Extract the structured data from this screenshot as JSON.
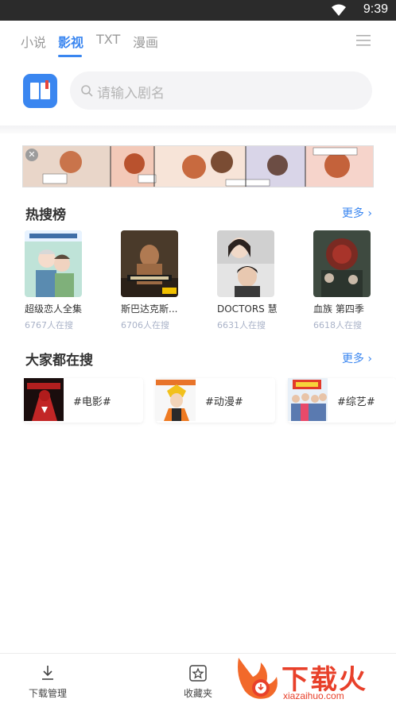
{
  "status_bar": {
    "time": "9:39",
    "wifi_icon": "wifi-icon"
  },
  "tabs": [
    {
      "label": "小说",
      "active": false
    },
    {
      "label": "影视",
      "active": true
    },
    {
      "label": "TXT",
      "active": false
    },
    {
      "label": "漫画",
      "active": false
    }
  ],
  "menu_icon": "hamburger-menu-icon",
  "search": {
    "placeholder": "请输入剧名",
    "icon": "search-icon"
  },
  "accent_color": "#3a86f0",
  "banner": {
    "close_symbol": "✕"
  },
  "hot_list": {
    "title": "热搜榜",
    "more_label": "更多 ›",
    "items": [
      {
        "title": "超级恋人全集",
        "count": "6767人在搜"
      },
      {
        "title": "斯巴达克斯...",
        "count": "6706人在搜"
      },
      {
        "title": "DOCTORS 慧",
        "count": "6631人在搜"
      },
      {
        "title": "血族 第四季",
        "count": "6618人在搜"
      }
    ]
  },
  "everyone_searching": {
    "title": "大家都在搜",
    "more_label": "更多 ›",
    "tags": [
      {
        "label": "#电影#"
      },
      {
        "label": "#动漫#"
      },
      {
        "label": "#综艺#"
      }
    ]
  },
  "bottom_nav": {
    "items": [
      {
        "label": "下载管理",
        "icon": "download-icon"
      },
      {
        "label": "收藏夹",
        "icon": "favorites-star-icon"
      }
    ]
  },
  "watermark": {
    "text": "下载火",
    "url": "xiazaihuo.com"
  }
}
